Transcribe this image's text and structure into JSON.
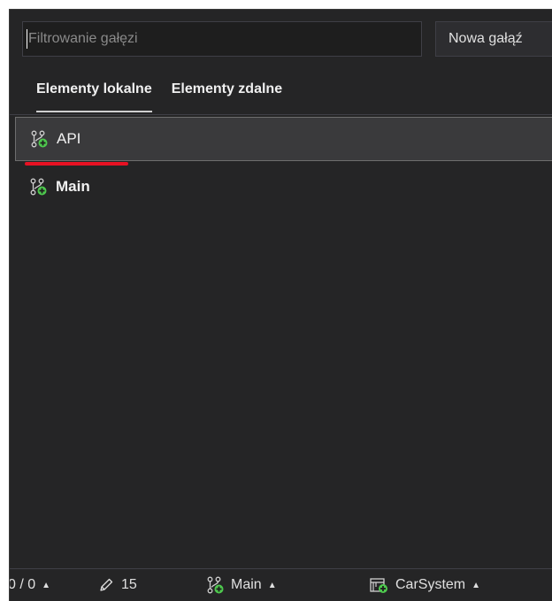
{
  "toolbar": {
    "filter_placeholder": "Filtrowanie gałęzi",
    "new_branch_label": "Nowa gałąź"
  },
  "tabs": [
    {
      "label": "Elementy lokalne",
      "active": true
    },
    {
      "label": "Elementy zdalne",
      "active": false
    }
  ],
  "branches": [
    {
      "name": "API",
      "selected": true,
      "bold": false,
      "icon": "branch-icon"
    },
    {
      "name": "Main",
      "selected": false,
      "bold": true,
      "icon": "branch-icon"
    }
  ],
  "statusbar": {
    "sync": "0 / 0",
    "changes": "15",
    "branch": "Main",
    "repo": "CarSystem"
  },
  "colors": {
    "background": "#252526",
    "selection": "#3a3a3c",
    "highlight_underline": "#e81123",
    "icon_green": "#4ec94e"
  }
}
